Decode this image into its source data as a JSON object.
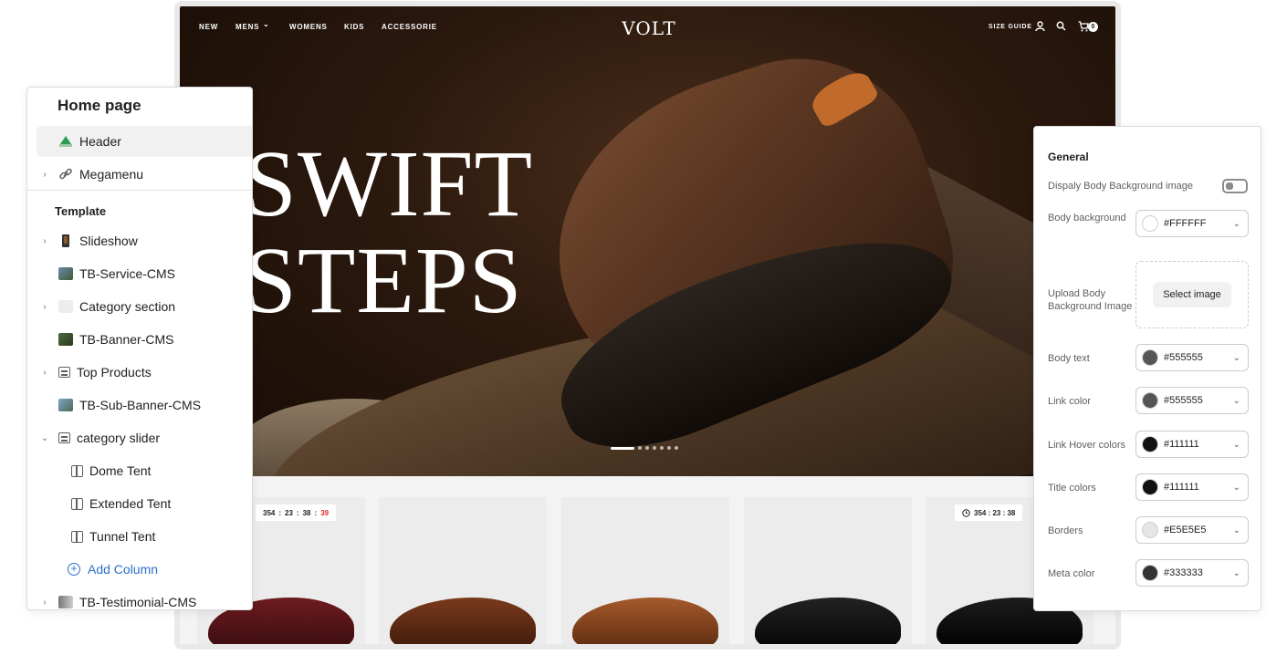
{
  "store": {
    "nav": {
      "new": "NEW",
      "mens": "MENS",
      "mens_caret": "⌄",
      "womens": "WOMENS",
      "kids": "KIDS",
      "accessorie": "ACCESSORIE",
      "size_guide": "SIZE GUIDE",
      "cart_count": "0"
    },
    "brand": "VOLT",
    "hero": {
      "line1": "SWIFT",
      "line2": "STEPS"
    },
    "timers": [
      {
        "hours": "354",
        "minutes": "23",
        "seconds_a": "38",
        "seconds_b": "39",
        "prefix_a": "",
        "visible": "354 : 23 : 38 : 39"
      },
      {
        "visible": "354 : 23 : 38"
      }
    ]
  },
  "outline": {
    "title": "Home page",
    "header": "Header",
    "megamenu": "Megamenu",
    "template_heading": "Template",
    "items": [
      "Slideshow",
      "TB-Service-CMS",
      "Category section",
      "TB-Banner-CMS",
      "Top Products",
      "TB-Sub-Banner-CMS",
      "category slider",
      "Dome Tent",
      "Extended Tent",
      "Tunnel Tent",
      "Add Column",
      "TB-Testimonial-CMS"
    ]
  },
  "settings": {
    "heading": "General",
    "display_bg_label": "Dispaly Body Background image",
    "display_bg_on": false,
    "body_bg_label": "Body background",
    "body_bg_value": "#FFFFFF",
    "upload_label": "Upload Body Background Image",
    "select_image": "Select image",
    "body_text_label": "Body text",
    "body_text_value": "#555555",
    "link_label": "Link color",
    "link_value": "#555555",
    "link_hover_label": "Link Hover colors",
    "link_hover_value": "#111111",
    "title_label": "Title colors",
    "title_value": "#111111",
    "borders_label": "Borders",
    "borders_value": "#E5E5E5",
    "meta_label": "Meta color",
    "meta_value": "#333333",
    "chevron": "⌄"
  }
}
